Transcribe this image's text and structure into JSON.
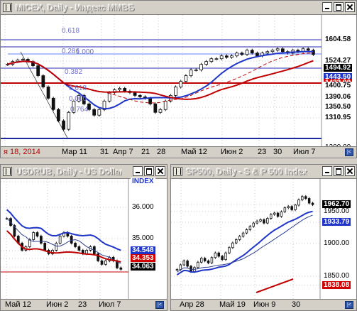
{
  "colors": {
    "background": "#d4d0c8",
    "chart_bg": "#ffffff",
    "ma_blue": "#1f35c8",
    "ma_red": "#c00000",
    "candle": "#111111",
    "tag_black": "#000000",
    "tag_blue": "#1f35c8",
    "tag_red": "#d00000"
  },
  "windows": [
    {
      "id": "micex",
      "title": "MICEX, Daily - Индекс ММВБ",
      "x_labels": [
        "я 18, 2014",
        "Мар 11",
        "31",
        "Апр 7",
        "21",
        "28",
        "Май 12",
        "Июн 2",
        "23",
        "30",
        "Июл 7"
      ],
      "price_levels": [
        "1604.58",
        "1524.27",
        "1494.92",
        "1443.50",
        "1422.90",
        "1400.75",
        "1390.06",
        "1350.50",
        "1310.95",
        "1200.00"
      ],
      "fib_labels": [
        "0.618",
        "0.286",
        "1.000",
        "0.382",
        "0.618",
        "0.000",
        "0.764"
      ]
    },
    {
      "id": "usdrub",
      "title": "USDRUB, Daily - US Dollar vs",
      "x_labels": [
        "Май 12",
        "Июн 2",
        "23",
        "Июл 7"
      ],
      "price_levels": [
        "INDEX",
        "36.000",
        "35.000",
        "34.548",
        "34.353",
        "34.063"
      ]
    },
    {
      "id": "sp500",
      "title": "SP500, Daily - S & P 500 Index",
      "x_labels": [
        "Апр 28",
        "Май 19",
        "Июн 9",
        "30"
      ],
      "price_levels": [
        "1962.70",
        "1950.00",
        "1933.79",
        "1900.00",
        "1850.00",
        "1838.08"
      ]
    }
  ],
  "chart_data": [
    {
      "type": "candlestick",
      "title": "MICEX, Daily - Индекс ММВБ",
      "x": [
        "я 18, 2014",
        "Мар 11",
        "31",
        "Апр 7",
        "21",
        "28",
        "Май 12",
        "Июн 2",
        "23",
        "30",
        "Июл 7"
      ],
      "series": [
        {
          "values": [
            1460,
            1470,
            1475,
            1478,
            1470,
            1455,
            1420,
            1380,
            1340,
            1300,
            1260,
            1230,
            1290,
            1330,
            1350,
            1320,
            1300,
            1280,
            1300,
            1330,
            1360,
            1370,
            1375,
            1365,
            1360,
            1350,
            1345,
            1340,
            1320,
            1290,
            1300,
            1330,
            1350,
            1380,
            1400,
            1420,
            1440,
            1440,
            1460,
            1470,
            1480,
            1480,
            1490,
            1485,
            1490,
            1500,
            1495,
            1510,
            1500,
            1490,
            1500,
            1505,
            1510,
            1515,
            1505,
            1500,
            1510,
            1505,
            1515,
            1510,
            1495
          ]
        }
      ],
      "ylim": [
        1180,
        1620
      ],
      "fibonacci": [
        "0.618",
        "0.286",
        "1.000",
        "0.382",
        "0.618",
        "0.000",
        "0.764"
      ]
    },
    {
      "type": "candlestick",
      "title": "USDRUB, Daily - US Dollar vs",
      "x": [
        "Май 12",
        "Июн 2",
        "23",
        "Июл 7"
      ],
      "series": [
        {
          "values": [
            35.5,
            35.3,
            35.0,
            34.8,
            34.6,
            34.7,
            34.9,
            35.1,
            35.0,
            34.8,
            34.6,
            34.5,
            34.6,
            34.8,
            35.0,
            35.1,
            35.0,
            34.8,
            34.7,
            34.6,
            34.5,
            34.6,
            34.7,
            34.5,
            34.3,
            34.2,
            34.3,
            34.4,
            34.3,
            34.1,
            34.06
          ]
        }
      ],
      "ylim": [
        33.3,
        36.5
      ]
    },
    {
      "type": "candlestick",
      "title": "SP500, Daily - S & P 500 Index",
      "x": [
        "Апр 28",
        "Май 19",
        "Июн 9",
        "30"
      ],
      "series": [
        {
          "values": [
            1865,
            1872,
            1878,
            1870,
            1862,
            1868,
            1876,
            1882,
            1878,
            1875,
            1883,
            1890,
            1885,
            1880,
            1890,
            1898,
            1905,
            1910,
            1915,
            1920,
            1925,
            1930,
            1935,
            1938,
            1940,
            1935,
            1942,
            1948,
            1950,
            1945,
            1952,
            1958,
            1960,
            1955,
            1962,
            1970,
            1975,
            1972,
            1965,
            1962.7
          ]
        }
      ],
      "ylim": [
        1825,
        1995
      ]
    }
  ]
}
